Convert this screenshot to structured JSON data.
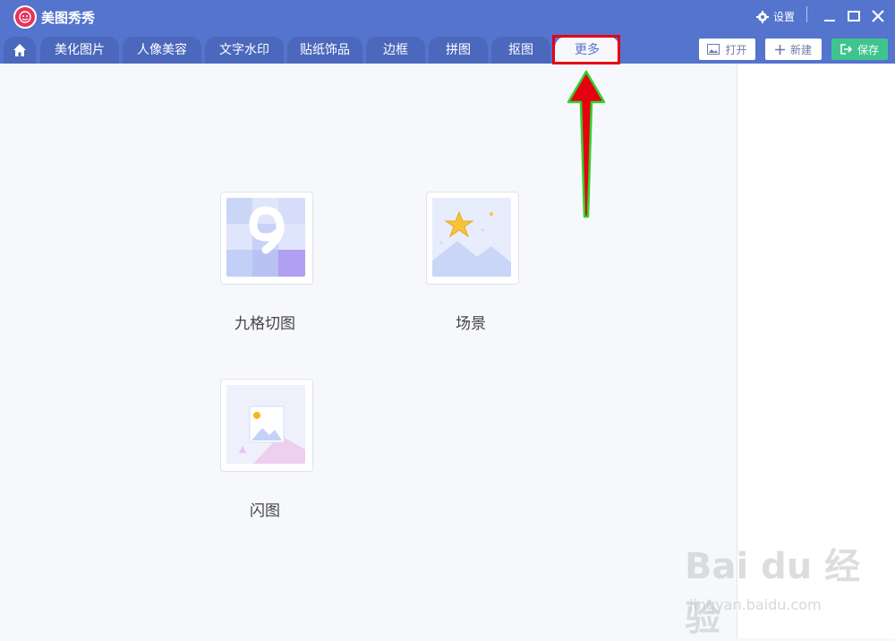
{
  "app": {
    "title": "美图秀秀"
  },
  "header": {
    "settings_label": "设置"
  },
  "tabs": [
    {
      "label": "美化图片"
    },
    {
      "label": "人像美容"
    },
    {
      "label": "文字水印"
    },
    {
      "label": "贴纸饰品"
    },
    {
      "label": "边框"
    },
    {
      "label": "拼图"
    },
    {
      "label": "抠图"
    },
    {
      "label": "更多"
    }
  ],
  "toolbar": {
    "open_label": "打开",
    "new_label": "新建",
    "save_label": "保存"
  },
  "tools": [
    {
      "label": "九格切图",
      "icon": "nine-grid-icon"
    },
    {
      "label": "场景",
      "icon": "scene-icon"
    },
    {
      "label": "闪图",
      "icon": "flash-image-icon"
    }
  ],
  "watermark": {
    "brand": "Bai du 经验",
    "url": "jingyan.baidu.com"
  },
  "colors": {
    "primary": "#5474cd",
    "save": "#3fc48f",
    "highlight": "#e60012",
    "arrow": "#e60012"
  }
}
